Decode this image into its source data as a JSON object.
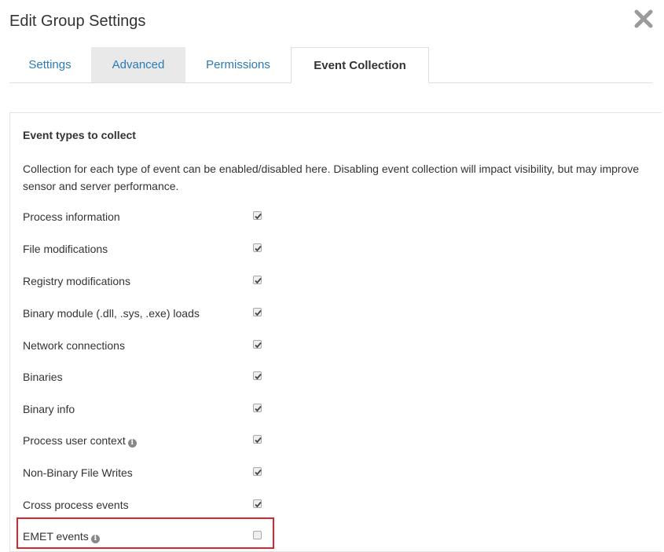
{
  "dialog": {
    "title": "Edit Group Settings",
    "close_icon": "close-icon"
  },
  "tabs": [
    {
      "label": "Settings",
      "state": "normal"
    },
    {
      "label": "Advanced",
      "state": "hover"
    },
    {
      "label": "Permissions",
      "state": "normal"
    },
    {
      "label": "Event Collection",
      "state": "active"
    }
  ],
  "panel": {
    "heading": "Event types to collect",
    "description": "Collection for each type of event can be enabled/disabled here. Disabling event collection will impact visibility, but may improve sensor and server performance."
  },
  "event_types": [
    {
      "label": "Process information",
      "checked": true,
      "info": false
    },
    {
      "label": "File modifications",
      "checked": true,
      "info": false
    },
    {
      "label": "Registry modifications",
      "checked": true,
      "info": false
    },
    {
      "label": "Binary module (.dll, .sys, .exe) loads",
      "checked": true,
      "info": false
    },
    {
      "label": "Network connections",
      "checked": true,
      "info": false
    },
    {
      "label": "Binaries",
      "checked": true,
      "info": false
    },
    {
      "label": "Binary info",
      "checked": true,
      "info": false
    },
    {
      "label": "Process user context",
      "checked": true,
      "info": true
    },
    {
      "label": "Non-Binary File Writes",
      "checked": true,
      "info": false
    },
    {
      "label": "Cross process events",
      "checked": true,
      "info": false
    },
    {
      "label": "EMET events",
      "checked": false,
      "info": true
    }
  ],
  "colors": {
    "tab_link": "#2a7ab8",
    "highlight": "#d9262e"
  }
}
